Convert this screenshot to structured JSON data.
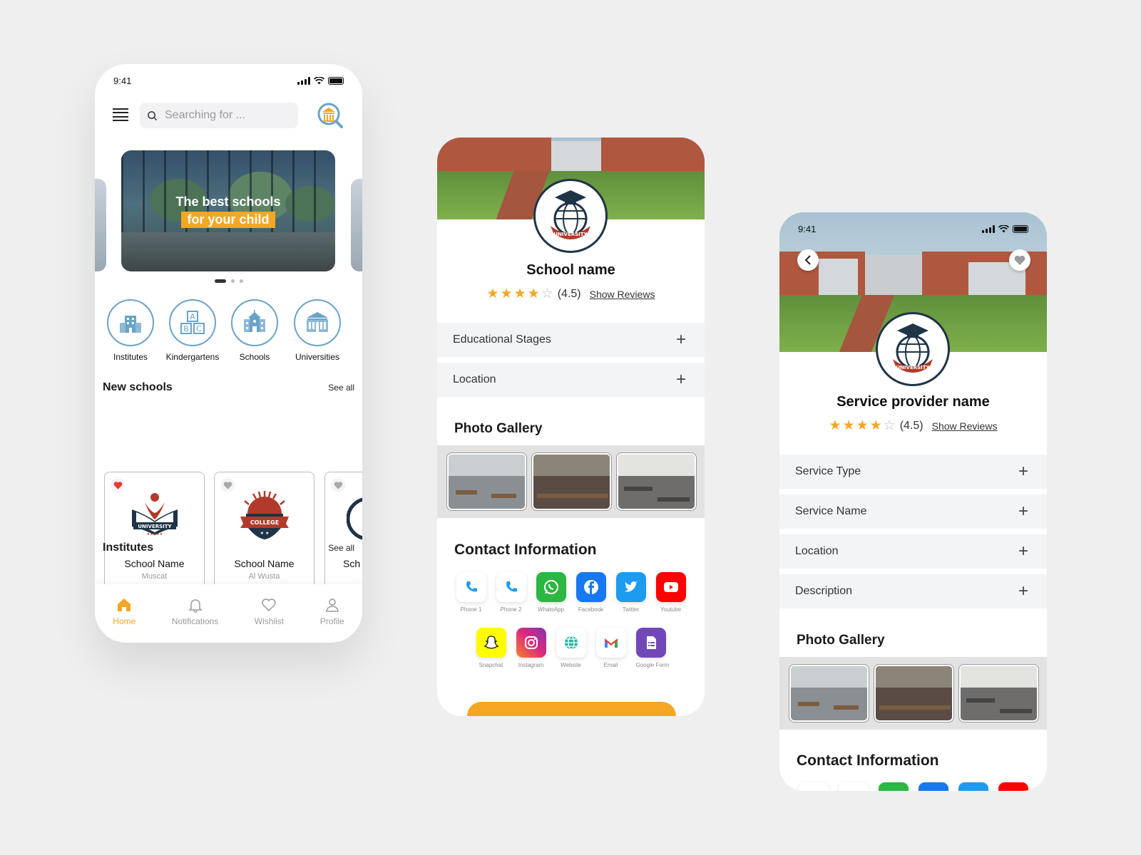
{
  "phone1": {
    "status_time": "9:41",
    "search": {
      "placeholder": "Searching for ..."
    },
    "banner": {
      "line1": "The best schools",
      "line2": "for your child"
    },
    "categories": [
      {
        "label": "Institutes",
        "icon": "building-icon"
      },
      {
        "label": "Kindergartens",
        "icon": "abc-blocks-icon"
      },
      {
        "label": "Schools",
        "icon": "school-icon"
      },
      {
        "label": "Universities",
        "icon": "university-icon"
      }
    ],
    "new_schools": {
      "title": "New schools",
      "see_all": "See all",
      "cards": [
        {
          "name": "School Name",
          "city": "Muscat",
          "favorite": true
        },
        {
          "name": "School Name",
          "city": "Al Wusta",
          "favorite": false
        },
        {
          "name": "Sch",
          "city": "",
          "favorite": false
        }
      ]
    },
    "institutes": {
      "title": "Institutes",
      "see_all": "See all"
    },
    "tabs": [
      {
        "label": "Home",
        "icon": "home-icon",
        "active": true
      },
      {
        "label": "Notifications",
        "icon": "bell-icon",
        "active": false
      },
      {
        "label": "Wishlist",
        "icon": "heart-icon",
        "active": false
      },
      {
        "label": "Profile",
        "icon": "user-icon",
        "active": false
      }
    ],
    "logo_text_university": "UNIVERSITY",
    "logo_text_college": "COLLEGE"
  },
  "phone2": {
    "title": "School name",
    "rating": "(4.5)",
    "stars": 4,
    "show_reviews": "Show Reviews",
    "sections": [
      "Educational Stages",
      "Location"
    ],
    "gallery_title": "Photo Gallery",
    "contact_title": "Contact Information",
    "contacts_row1": [
      {
        "label": "Phone 1",
        "icon": "phone-icon",
        "color": "#ffffff"
      },
      {
        "label": "Phone 2",
        "icon": "phone-icon",
        "color": "#ffffff"
      },
      {
        "label": "WhatsApp",
        "icon": "whatsapp-icon",
        "color": "#2bb741"
      },
      {
        "label": "Facebook",
        "icon": "facebook-icon",
        "color": "#1877f2"
      },
      {
        "label": "Twitter",
        "icon": "twitter-icon",
        "color": "#1d9bf0"
      },
      {
        "label": "Youtube",
        "icon": "youtube-icon",
        "color": "#ff0000"
      }
    ],
    "contacts_row2": [
      {
        "label": "Snapchat",
        "icon": "snapchat-icon",
        "color": "#fffc00"
      },
      {
        "label": "Instagram",
        "icon": "instagram-icon",
        "color": "#e1306c"
      },
      {
        "label": "Website",
        "icon": "globe-icon",
        "color": "#ffffff"
      },
      {
        "label": "Email",
        "icon": "gmail-icon",
        "color": "#ffffff"
      },
      {
        "label": "Google Form",
        "icon": "form-icon",
        "color": "#7248b9"
      }
    ],
    "badge_text": "UNIVERSITY"
  },
  "phone3": {
    "status_time": "9:41",
    "title": "Service provider name",
    "rating": "(4.5)",
    "stars": 4,
    "show_reviews": "Show Reviews",
    "sections": [
      "Service Type",
      "Service Name",
      "Location",
      "Description"
    ],
    "gallery_title": "Photo Gallery",
    "contact_title": "Contact Information",
    "badge_text": "UNIVERSITY"
  },
  "colors": {
    "accent": "#f5a623",
    "category_ring": "#6aa3c8",
    "heart_active": "#e53935",
    "navy": "#1f3446"
  }
}
